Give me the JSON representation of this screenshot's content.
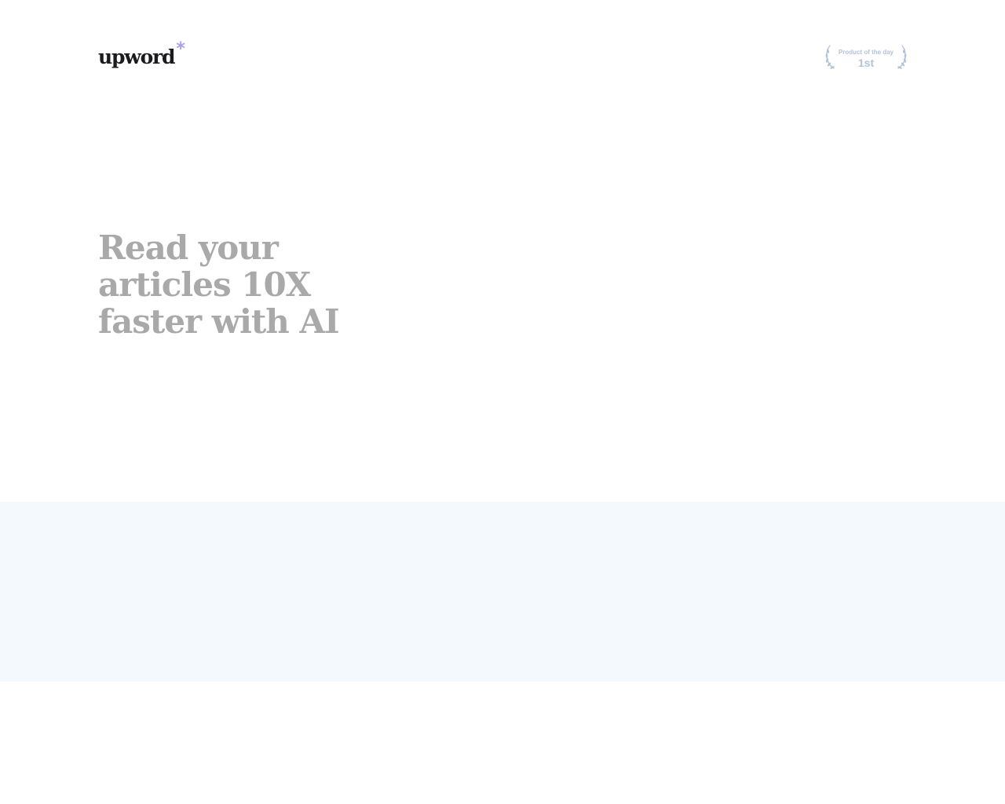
{
  "header": {
    "logo": {
      "text": "upword",
      "accent": "*"
    },
    "badge": {
      "label": "Product of the day",
      "rank": "1st"
    }
  },
  "hero": {
    "title_lines": [
      "Read your",
      "articles 10X",
      "faster with AI"
    ]
  },
  "colors": {
    "logo_text": "#1b1b1f",
    "logo_accent": "#a99cf0",
    "hero_title": "#a9a9a9",
    "badge": "#b4c3d6",
    "band_background": "#f4f9fd",
    "page_background": "#ffffff"
  }
}
